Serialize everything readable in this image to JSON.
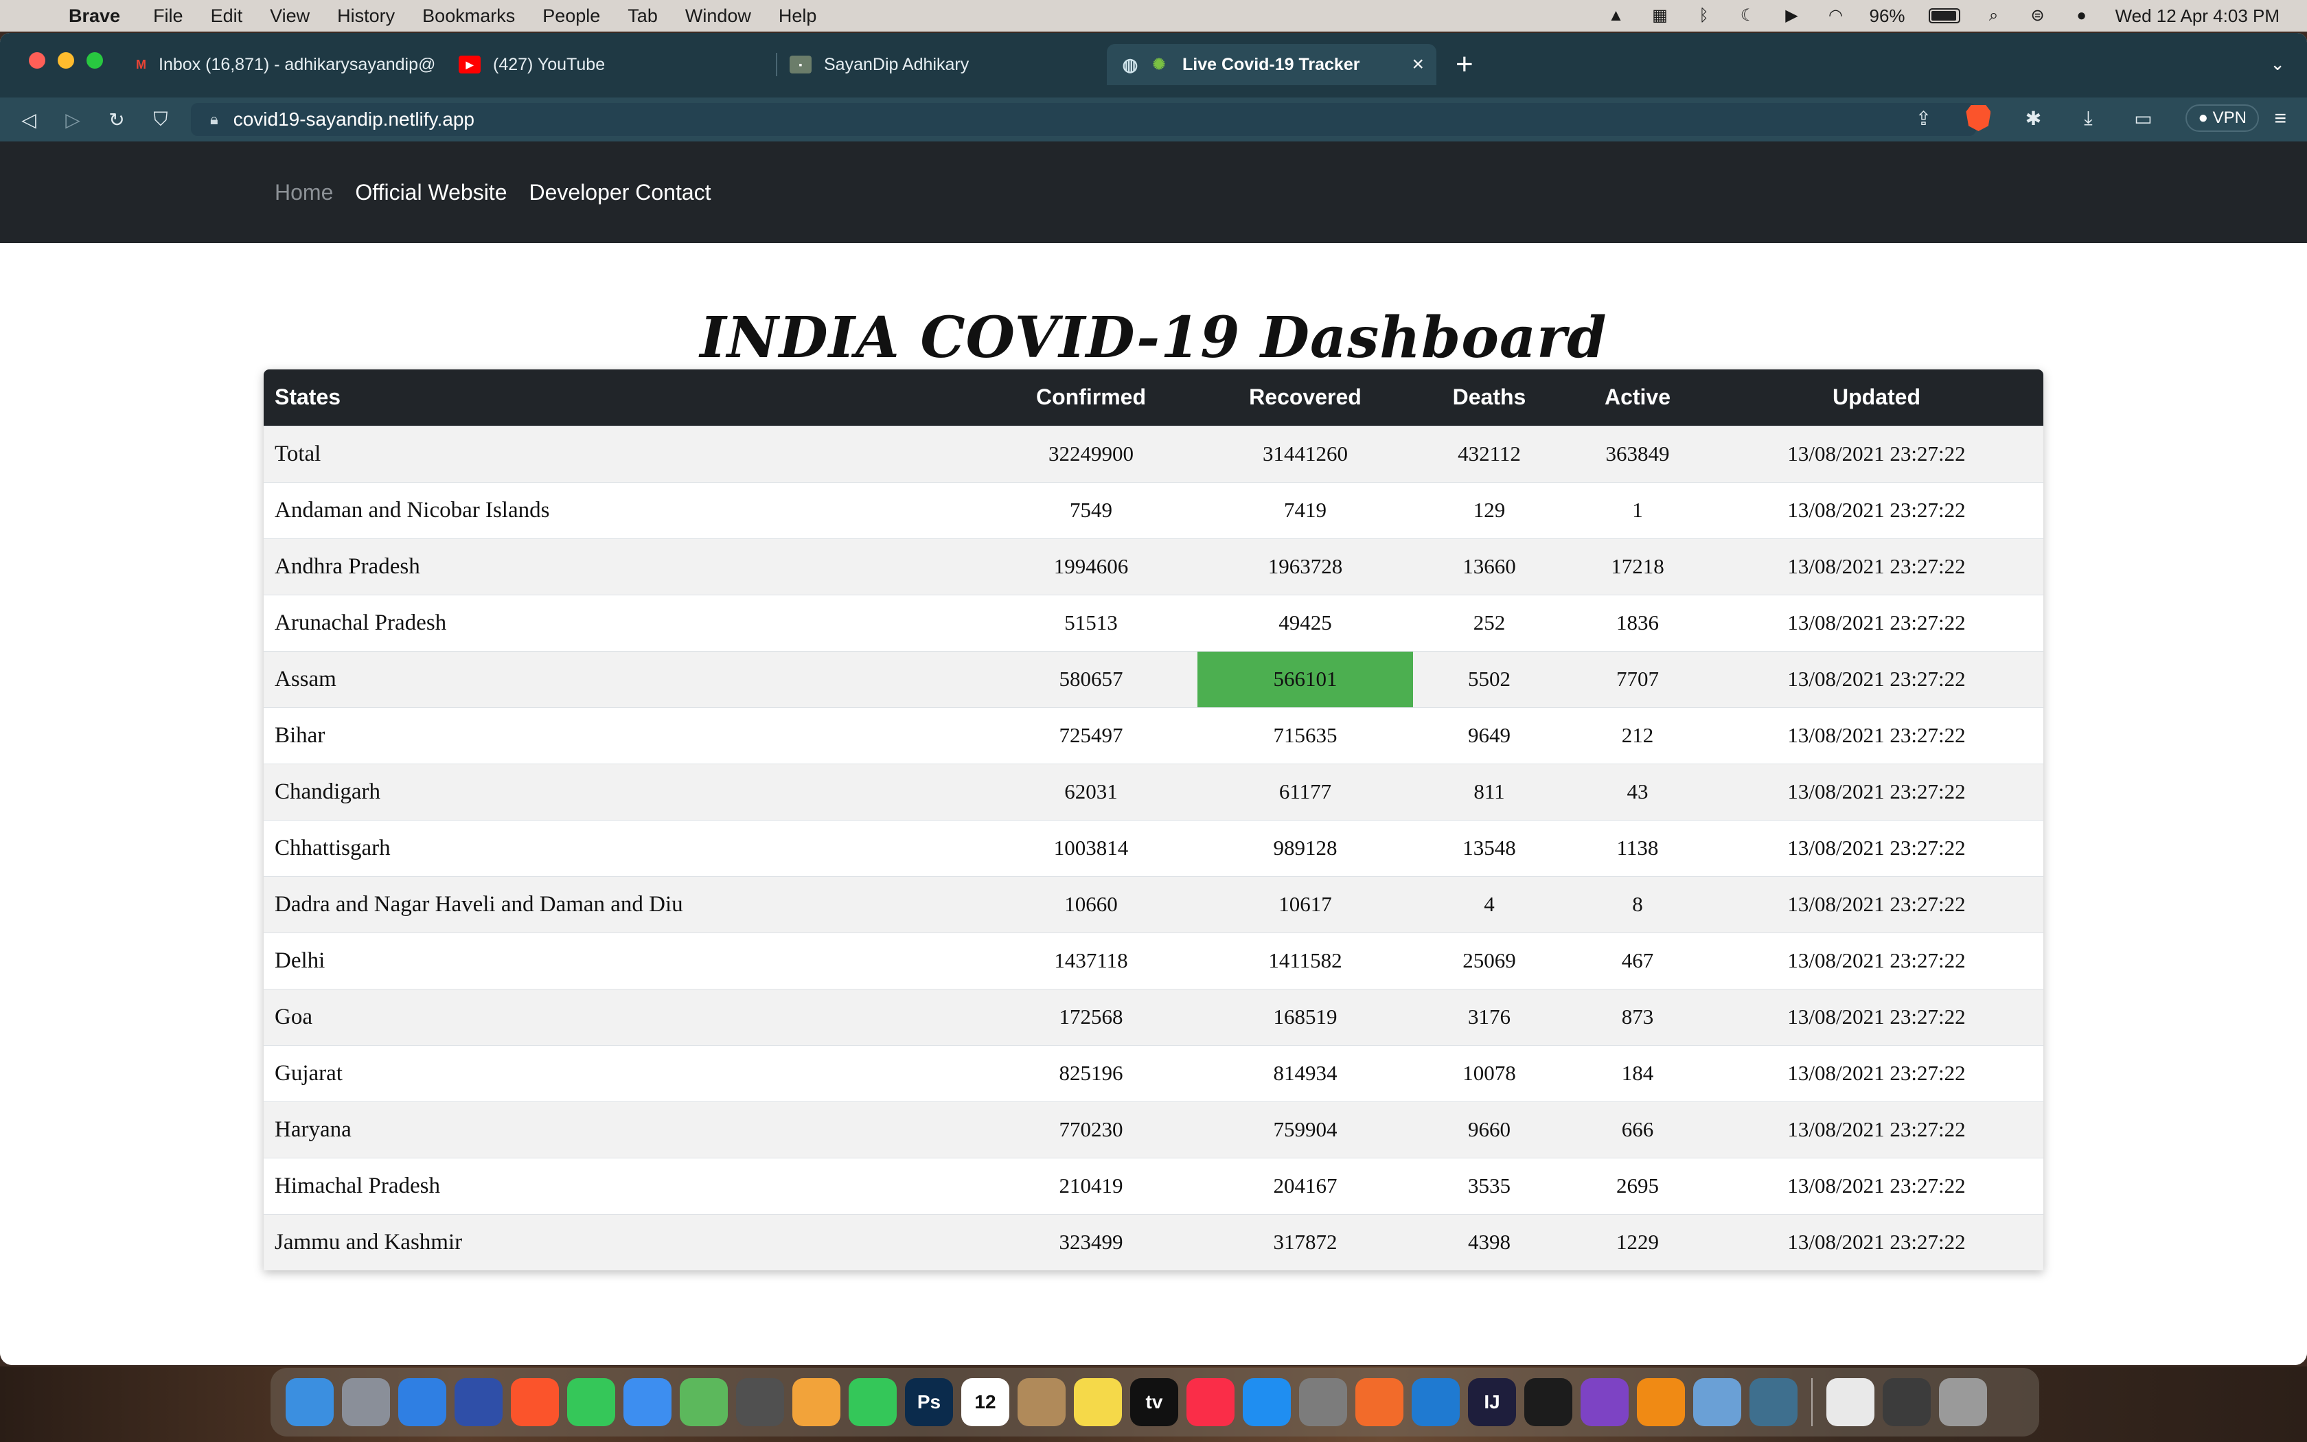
{
  "menubar": {
    "app_name": "Brave",
    "items": [
      "File",
      "Edit",
      "View",
      "History",
      "Bookmarks",
      "People",
      "Tab",
      "Window",
      "Help"
    ],
    "battery_percent": "96%",
    "battery_level": 0.96,
    "datetime": "Wed 12 Apr  4:03 PM",
    "status_icons": [
      "vlc-icon",
      "keyboard-icon",
      "bluetooth-icon",
      "moon-icon",
      "play-icon",
      "wifi-icon",
      "search-icon",
      "control-center-icon",
      "siri-icon"
    ]
  },
  "browser": {
    "tabs": [
      {
        "title": "Inbox (16,871) - adhikarysayandip@",
        "icon": "gmail-icon",
        "color": "#ea4335"
      },
      {
        "title": "(427) YouTube",
        "icon": "youtube-icon",
        "color": "#ff0000"
      },
      {
        "title": "SayanDip Adhikary",
        "icon": "page-icon",
        "color": "#6b7d6a"
      },
      {
        "title": "Live Covid-19 Tracker",
        "icon": "globe-icon",
        "color": "#7ac143",
        "active": true
      }
    ],
    "url": "covid19-sayandip.netlify.app",
    "vpn_label": "VPN"
  },
  "site": {
    "nav": [
      {
        "label": "Home",
        "active": true
      },
      {
        "label": "Official Website"
      },
      {
        "label": "Developer Contact"
      }
    ],
    "title": "INDIA COVID-19 Dashboard",
    "table": {
      "headers": [
        "States",
        "Confirmed",
        "Recovered",
        "Deaths",
        "Active",
        "Updated"
      ],
      "rows": [
        [
          "Total",
          "32249900",
          "31441260",
          "432112",
          "363849",
          "13/08/2021 23:27:22"
        ],
        [
          "Andaman and Nicobar Islands",
          "7549",
          "7419",
          "129",
          "1",
          "13/08/2021 23:27:22"
        ],
        [
          "Andhra Pradesh",
          "1994606",
          "1963728",
          "13660",
          "17218",
          "13/08/2021 23:27:22"
        ],
        [
          "Arunachal Pradesh",
          "51513",
          "49425",
          "252",
          "1836",
          "13/08/2021 23:27:22"
        ],
        [
          "Assam",
          "580657",
          "566101",
          "5502",
          "7707",
          "13/08/2021 23:27:22"
        ],
        [
          "Bihar",
          "725497",
          "715635",
          "9649",
          "212",
          "13/08/2021 23:27:22"
        ],
        [
          "Chandigarh",
          "62031",
          "61177",
          "811",
          "43",
          "13/08/2021 23:27:22"
        ],
        [
          "Chhattisgarh",
          "1003814",
          "989128",
          "13548",
          "1138",
          "13/08/2021 23:27:22"
        ],
        [
          "Dadra and Nagar Haveli and Daman and Diu",
          "10660",
          "10617",
          "4",
          "8",
          "13/08/2021 23:27:22"
        ],
        [
          "Delhi",
          "1437118",
          "1411582",
          "25069",
          "467",
          "13/08/2021 23:27:22"
        ],
        [
          "Goa",
          "172568",
          "168519",
          "3176",
          "873",
          "13/08/2021 23:27:22"
        ],
        [
          "Gujarat",
          "825196",
          "814934",
          "10078",
          "184",
          "13/08/2021 23:27:22"
        ],
        [
          "Haryana",
          "770230",
          "759904",
          "9660",
          "666",
          "13/08/2021 23:27:22"
        ],
        [
          "Himachal Pradesh",
          "210419",
          "204167",
          "3535",
          "2695",
          "13/08/2021 23:27:22"
        ],
        [
          "Jammu and Kashmir",
          "323499",
          "317872",
          "4398",
          "1229",
          "13/08/2021 23:27:22"
        ]
      ],
      "highlight_color": "#4caf50"
    }
  },
  "dock": {
    "apps": [
      {
        "name": "finder-icon",
        "color": "#3b8fe0"
      },
      {
        "name": "launchpad-icon",
        "color": "#8a8f99"
      },
      {
        "name": "safari-icon",
        "color": "#2f7fe3"
      },
      {
        "name": "firefox-icon",
        "color": "#2f4fa8"
      },
      {
        "name": "brave-icon",
        "color": "#fb542b"
      },
      {
        "name": "messages-icon",
        "color": "#35c759"
      },
      {
        "name": "mail-icon",
        "color": "#3d8ef0"
      },
      {
        "name": "maps-icon",
        "color": "#5cb85c"
      },
      {
        "name": "calculator-icon",
        "color": "#505050"
      },
      {
        "name": "photos-icon",
        "color": "#f2a33a"
      },
      {
        "name": "facetime-icon",
        "color": "#34c759"
      },
      {
        "name": "photoshop-icon",
        "color": "#0b2b4c",
        "text": "Ps"
      },
      {
        "name": "calendar-icon",
        "color": "#ffffff",
        "text": "12"
      },
      {
        "name": "contacts-icon",
        "color": "#b08a5a"
      },
      {
        "name": "notes-icon",
        "color": "#f5d949"
      },
      {
        "name": "apple-tv-icon",
        "color": "#111111",
        "text": "tv"
      },
      {
        "name": "music-icon",
        "color": "#fa2d48"
      },
      {
        "name": "app-store-icon",
        "color": "#1f8ef1"
      },
      {
        "name": "system-preferences-icon",
        "color": "#7c7c7c"
      },
      {
        "name": "sketch-icon",
        "color": "#f26b2a"
      },
      {
        "name": "vscode-icon",
        "color": "#1f7ad1"
      },
      {
        "name": "intellij-icon",
        "color": "#1e1e3c",
        "text": "IJ"
      },
      {
        "name": "terminal-icon",
        "color": "#1c1c1c"
      },
      {
        "name": "github-desktop-icon",
        "color": "#7d43c4"
      },
      {
        "name": "vlc-icon",
        "color": "#f08a14"
      },
      {
        "name": "virtualbox-icon",
        "color": "#6aa0d6"
      },
      {
        "name": "mysql-workbench-icon",
        "color": "#3e6f8e"
      },
      {
        "name": "sep",
        "color": ""
      },
      {
        "name": "document-icon",
        "color": "#e9e9e9"
      },
      {
        "name": "screenshot-stack-icon",
        "color": "#3c3c3c"
      },
      {
        "name": "trash-icon",
        "color": "#9a9a9a"
      }
    ]
  }
}
